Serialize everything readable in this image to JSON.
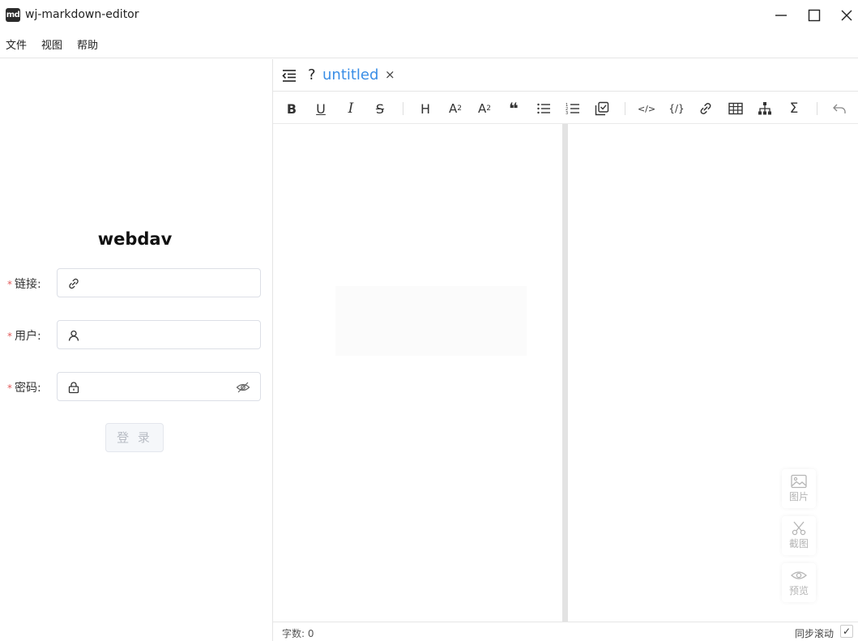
{
  "app": {
    "logo_text": "md",
    "title": "wj-markdown-editor"
  },
  "menu": {
    "items": [
      "文件",
      "视图",
      "帮助"
    ]
  },
  "login": {
    "title": "webdav",
    "required_mark": "*",
    "fields": [
      {
        "label": "链接:",
        "icon": "link-icon",
        "value": ""
      },
      {
        "label": "用户:",
        "icon": "user-icon",
        "value": ""
      },
      {
        "label": "密码:",
        "icon": "lock-icon",
        "value": ""
      }
    ],
    "submit_label": "登 录"
  },
  "tab": {
    "help": "?",
    "name": "untitled",
    "close": "×"
  },
  "toolbar": {
    "bold": "B",
    "underline": "U",
    "italic": "I",
    "strike": "S",
    "heading": "H",
    "subscript": "A",
    "superscript": "A",
    "sub_mark": "2",
    "sup_mark": "2",
    "quote": "❝",
    "code_block": "</>",
    "inline_code": "{/}",
    "sum": "Σ"
  },
  "floating": {
    "image": "图片",
    "screenshot": "截图",
    "preview": "预览"
  },
  "status": {
    "word_count": "字数: 0",
    "sync_scroll": "同步滚动",
    "sync_checked": "✓"
  }
}
